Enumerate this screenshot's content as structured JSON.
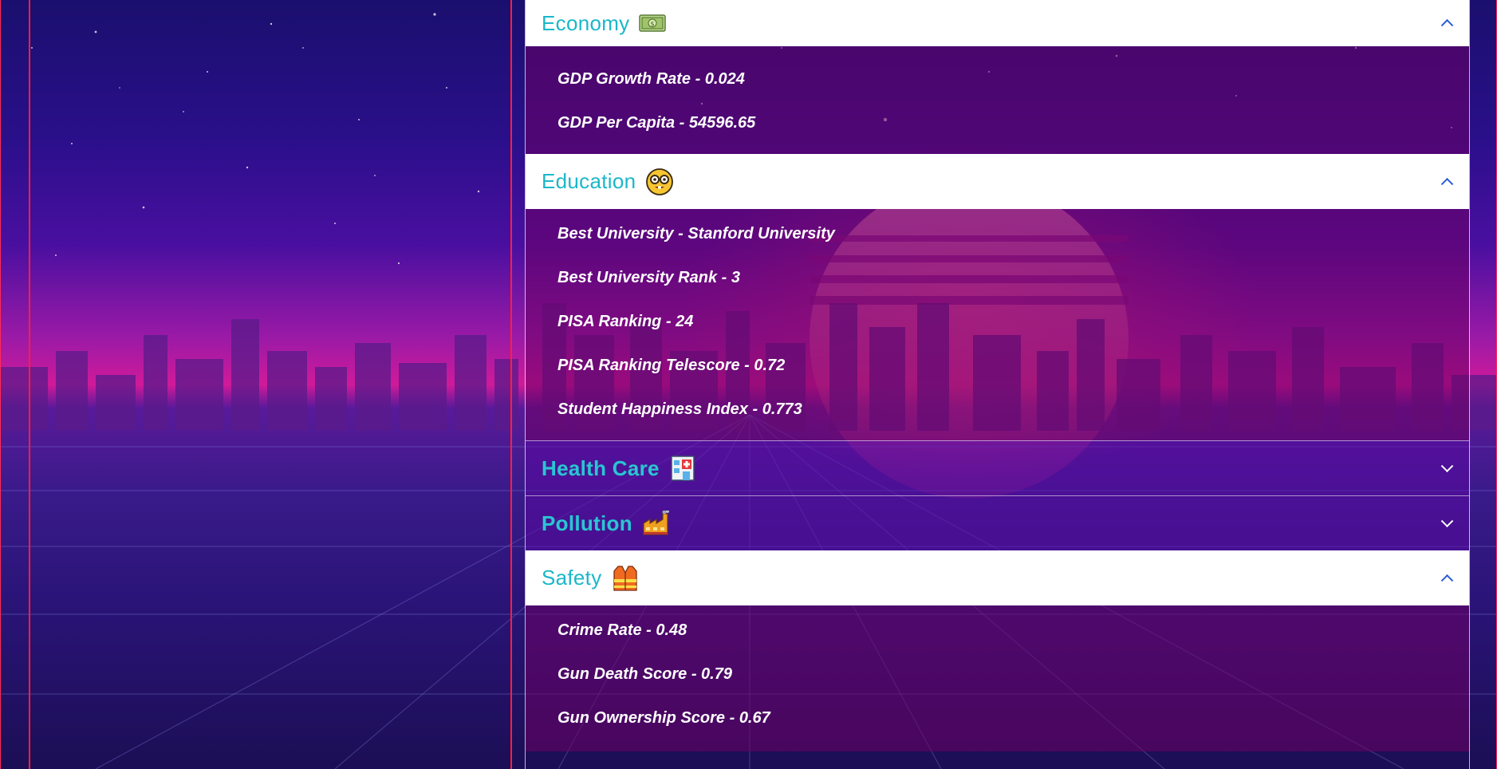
{
  "sections": [
    {
      "title": "Economy",
      "icon": "money-icon",
      "expanded": true,
      "items": [
        "GDP Growth Rate - 0.024",
        "GDP Per Capita - 54596.65"
      ]
    },
    {
      "title": "Education",
      "icon": "nerd-face-icon",
      "expanded": true,
      "items": [
        "Best University - Stanford University",
        "Best University Rank - 3",
        "PISA Ranking - 24",
        "PISA Ranking Telescore - 0.72",
        "Student Happiness Index - 0.773"
      ]
    },
    {
      "title": "Health Care",
      "icon": "hospital-icon",
      "expanded": false,
      "items": []
    },
    {
      "title": "Pollution",
      "icon": "factory-icon",
      "expanded": false,
      "items": []
    },
    {
      "title": "Safety",
      "icon": "safety-vest-icon",
      "expanded": true,
      "items": [
        "Crime Rate - 0.48",
        "Gun Death Score - 0.79",
        "Gun Ownership Score - 0.67"
      ]
    }
  ],
  "colors": {
    "header_title": "#1bb7c9",
    "chevron_open": "#2b5dd6",
    "panel_border": "#ff1f3d"
  }
}
